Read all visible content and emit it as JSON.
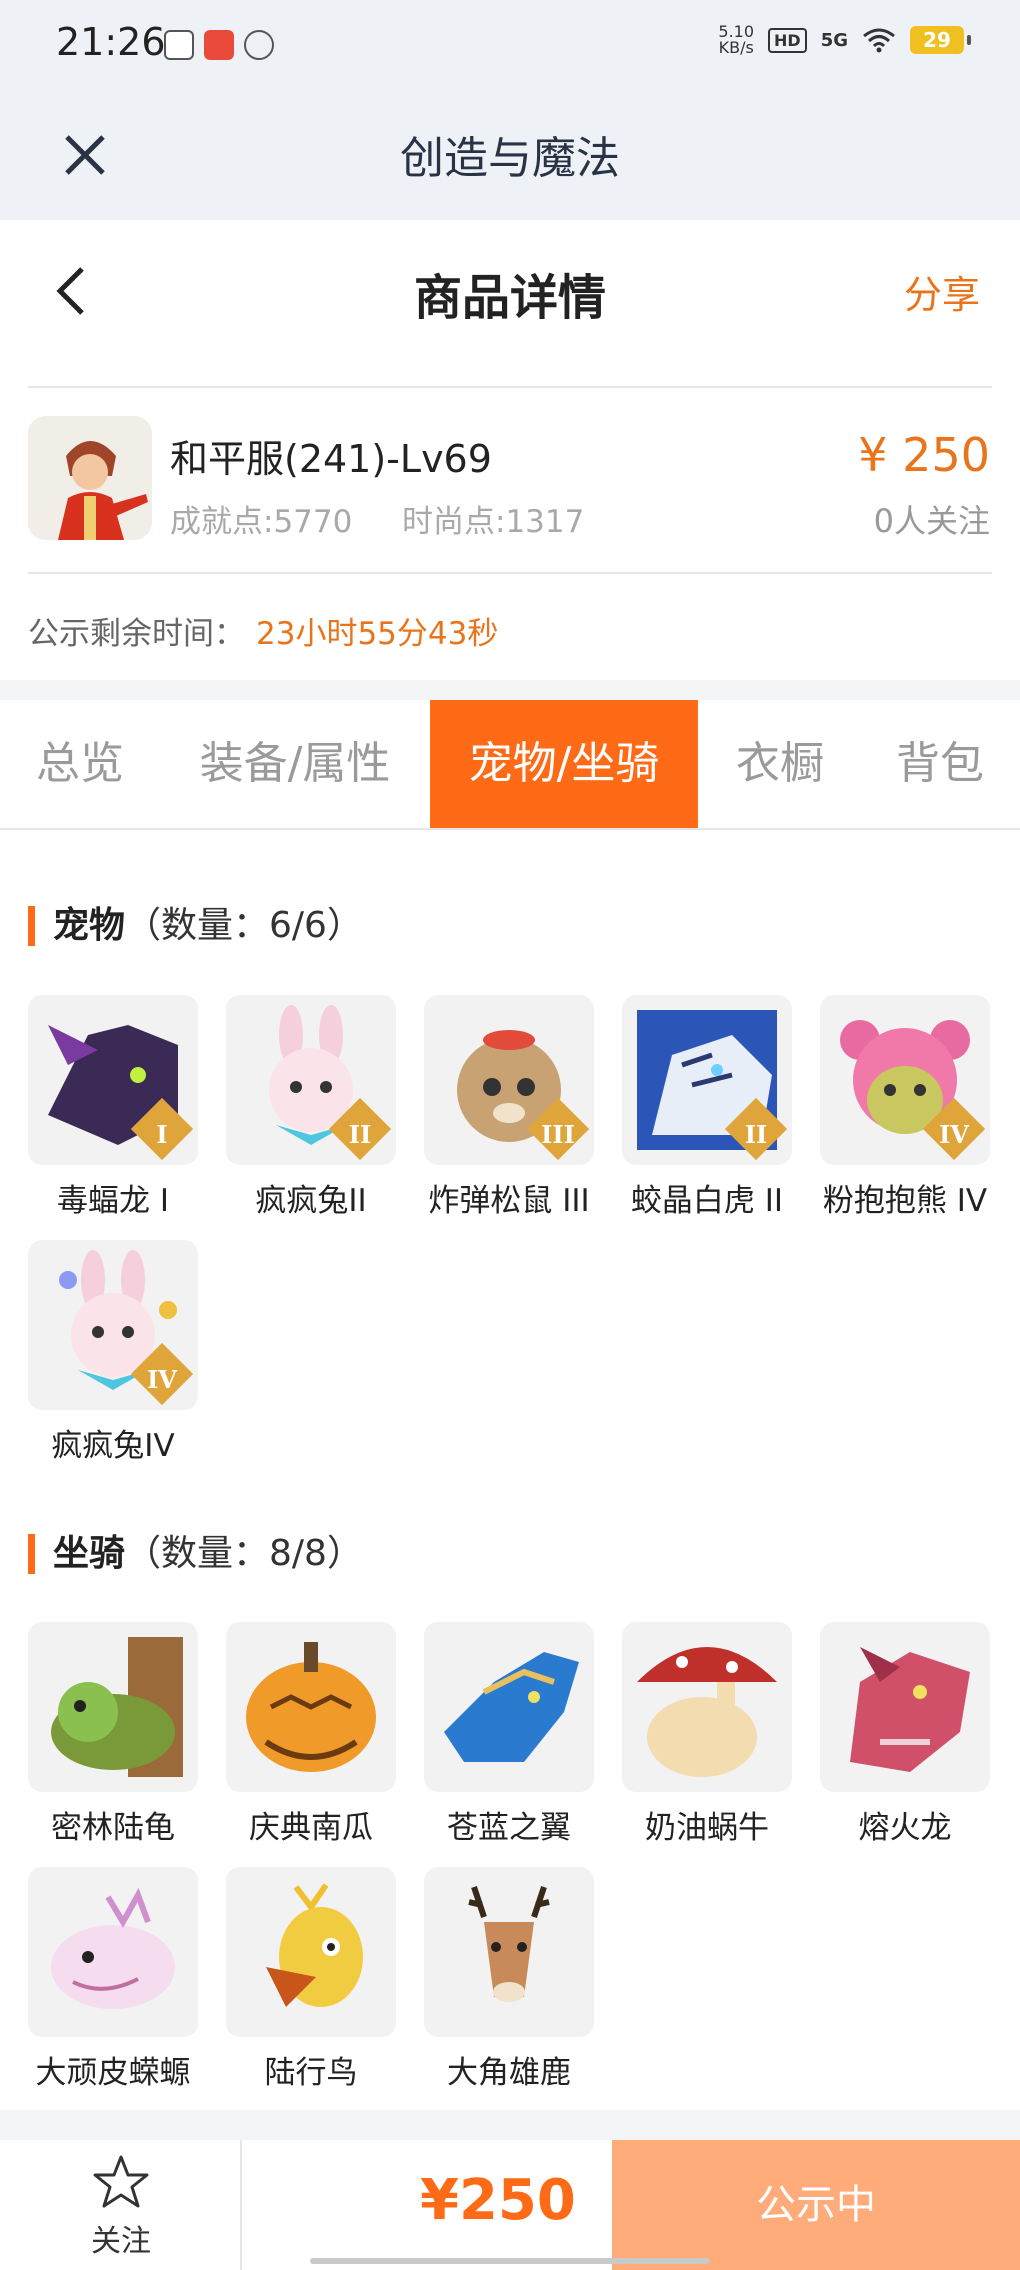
{
  "status_bar": {
    "time": "21:26",
    "net_speed_value": "5.10",
    "net_speed_unit": "KB/s",
    "hd": "HD",
    "signal": "5G",
    "battery": "29",
    "icons": [
      "app-du-icon",
      "app-red-icon",
      "app-circle-icon",
      "wifi-icon"
    ]
  },
  "app_header": {
    "title": "创造与魔法",
    "close_icon": "close-icon"
  },
  "page_header": {
    "title": "商品详情",
    "share": "分享",
    "back_icon": "back-arrow-icon"
  },
  "product": {
    "name": "和平服(241)-Lv69",
    "achievement": "成就点:5770",
    "fashion": "时尚点:1317",
    "price": "¥ 250",
    "followers": "0人关注",
    "countdown_label": "公示剩余时间：",
    "countdown_value": "23小时55分43秒"
  },
  "tabs": [
    {
      "label": "总览",
      "active": false
    },
    {
      "label": "装备/属性",
      "active": false
    },
    {
      "label": "宠物/坐骑",
      "active": true
    },
    {
      "label": "衣橱",
      "active": false
    },
    {
      "label": "背包",
      "active": false
    }
  ],
  "pets": {
    "title": "宠物",
    "count": "（数量：6/6）",
    "items": [
      {
        "label": "毒蝠龙 I",
        "tier": "I"
      },
      {
        "label": "疯疯兔II",
        "tier": "II"
      },
      {
        "label": "炸弹松鼠 III",
        "tier": "III"
      },
      {
        "label": "蛟晶白虎 II",
        "tier": "II"
      },
      {
        "label": "粉抱抱熊 IV",
        "tier": "IV"
      },
      {
        "label": "疯疯兔IV",
        "tier": "IV"
      }
    ]
  },
  "mounts": {
    "title": "坐骑",
    "count": "（数量：8/8）",
    "items": [
      {
        "label": "密林陆龟"
      },
      {
        "label": "庆典南瓜"
      },
      {
        "label": "苍蓝之翼"
      },
      {
        "label": "奶油蜗牛"
      },
      {
        "label": "熔火龙"
      },
      {
        "label": "大顽皮蝾螈"
      },
      {
        "label": "陆行鸟"
      },
      {
        "label": "大角雄鹿"
      }
    ]
  },
  "bottom_bar": {
    "follow": "关注",
    "price": "¥250",
    "status": "公示中"
  },
  "colors": {
    "accent": "#ff6a16",
    "price": "#e8741c",
    "status_button": "#ffab7a"
  }
}
